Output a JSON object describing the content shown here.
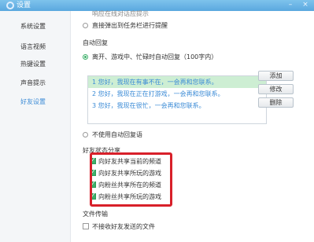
{
  "window": {
    "title": "设置",
    "controls": {
      "minimize": "–",
      "close": "×"
    }
  },
  "sidebar": {
    "items": [
      {
        "label": "系统设置",
        "active": false
      },
      {
        "label": "语言视频",
        "active": false
      },
      {
        "label": "热键设置",
        "active": false
      },
      {
        "label": "声音提示",
        "active": false
      },
      {
        "label": "好友设置",
        "active": true
      }
    ]
  },
  "main": {
    "top_cut_option": "响应在线对话应提示",
    "taskbar_option": "直接弹出到任务栏进行提醒",
    "auto_reply": {
      "heading": "自动回复",
      "enable_label": "离开、游戏中、忙碌时自动回复（100字内）",
      "replies": [
        "1  您好，我现在有事不在，一会再和您联系。",
        "2  您好，我现在正在打游戏，一会再和您联系。",
        "3  您好，我现在很忙，一会再和您联系。"
      ],
      "buttons": {
        "add": "添加",
        "edit": "修改",
        "delete": "删除"
      },
      "disable_label": "不使用自动回复语"
    },
    "status_share": {
      "heading": "好友状态分享",
      "options": [
        "向好友共享当前的频道",
        "向好友共享所玩的游戏",
        "向粉丝共享所在的频道",
        "向粉丝共享所玩的游戏"
      ]
    },
    "file_transfer": {
      "heading": "文件传输",
      "option": "不接收好友发送的文件"
    }
  },
  "colors": {
    "accent": "#3b8bd6",
    "selected_row": "#cdeed3",
    "highlight_box": "#d8202a",
    "check_green": "#3fb06b"
  }
}
